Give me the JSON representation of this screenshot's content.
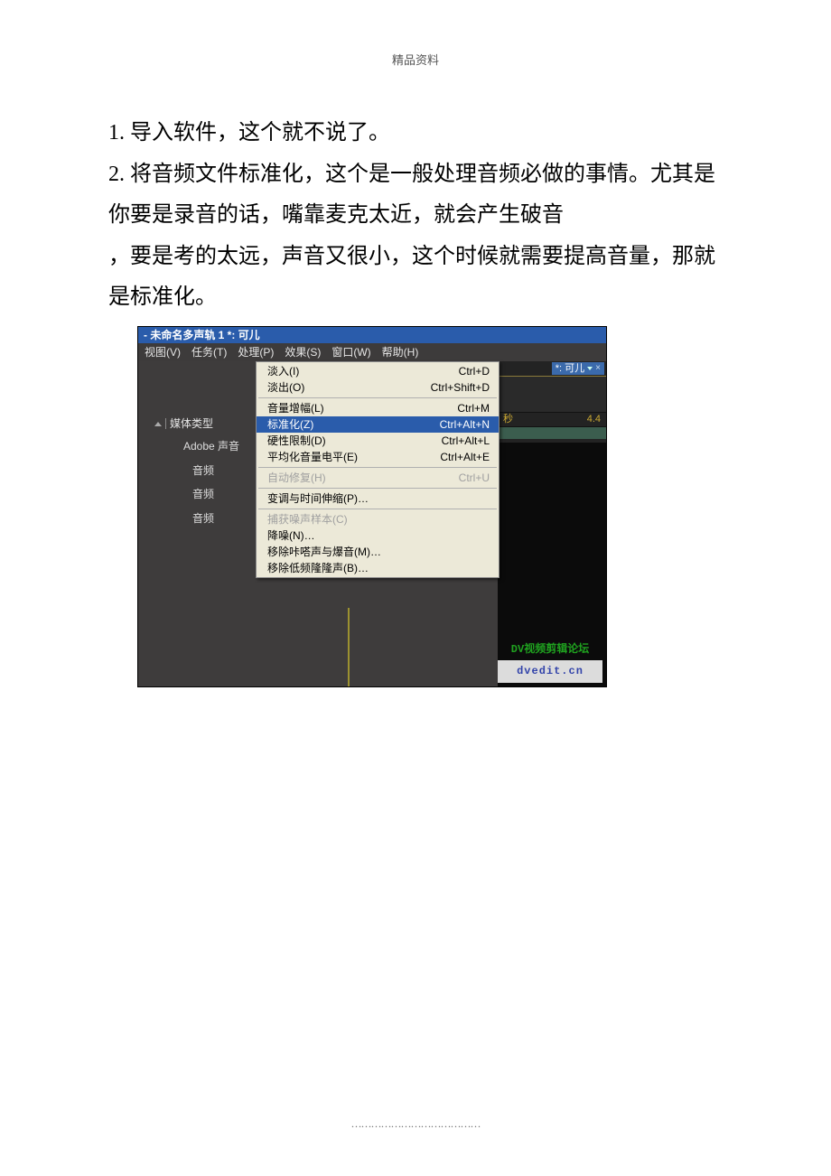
{
  "header": "精品资料",
  "body": {
    "line1": "1. 导入软件，这个就不说了。",
    "line2": "2. 将音频文件标准化，这个是一般处理音频必做的事情。尤其是你要是录音的话，嘴靠麦克太近，就会产生破音",
    "line3": "，要是考的太远，声音又很小，这个时候就需要提高音量，那就是标准化。"
  },
  "shot": {
    "title": " - 未命名多声轨 1 *: 可儿",
    "menubar": {
      "view": "视图(V)",
      "task": "任务(T)",
      "process": "处理(P)",
      "effect": "效果(S)",
      "window": "窗口(W)",
      "help": "帮助(H)"
    },
    "left": {
      "media_type": "媒体类型",
      "adobe": "Adobe 声音",
      "audio1": "音频",
      "audio2": "音频",
      "audio3": "音频"
    },
    "right": {
      "tab": "*: 可儿",
      "sec": "秒",
      "tick": "4.4"
    },
    "menu": {
      "fadein": {
        "l": "淡入(I)",
        "s": "Ctrl+D"
      },
      "fadeout": {
        "l": "淡出(O)",
        "s": "Ctrl+Shift+D"
      },
      "gain": {
        "l": "音量增幅(L)",
        "s": "Ctrl+M"
      },
      "normalize": {
        "l": "标准化(Z)",
        "s": "Ctrl+Alt+N"
      },
      "hardlimit": {
        "l": "硬性限制(D)",
        "s": "Ctrl+Alt+L"
      },
      "avglevel": {
        "l": "平均化音量电平(E)",
        "s": "Ctrl+Alt+E"
      },
      "autoheal": {
        "l": "自动修复(H)",
        "s": "Ctrl+U"
      },
      "pitch": {
        "l": "变调与时间伸缩(P)…",
        "s": ""
      },
      "capnoise": {
        "l": "捕获噪声样本(C)",
        "s": ""
      },
      "denoise": {
        "l": "降噪(N)…",
        "s": ""
      },
      "removeclick": {
        "l": "移除咔嗒声与爆音(M)…",
        "s": ""
      },
      "removerumble": {
        "l": "移除低频隆隆声(B)…",
        "s": ""
      }
    },
    "watermark": {
      "l1": "DV视频剪辑论坛",
      "l2": "dvedit.cn"
    }
  },
  "footer": "…………………………………"
}
